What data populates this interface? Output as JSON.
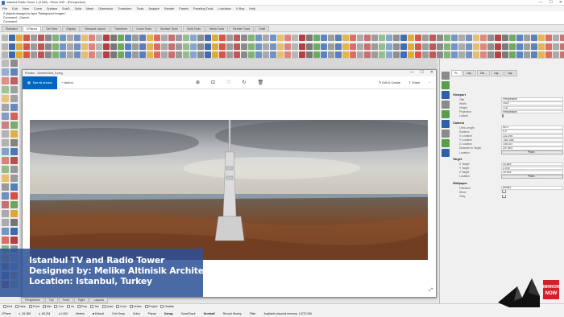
{
  "window": {
    "title": "Istanbul Radio Tower 1 (3 MB) - Rhino WIP - [Perspective]",
    "controls": [
      "—",
      "☐",
      "✕"
    ]
  },
  "menu": [
    "File",
    "Edit",
    "View",
    "Curve",
    "Surface",
    "SubD",
    "Solid",
    "Mesh",
    "Dimension",
    "Transform",
    "Tools",
    "Analyze",
    "Render",
    "Panels",
    "Paneling Tools",
    "Lunchbox",
    "V-Ray",
    "Help"
  ],
  "command_history": [
    "0 objects changed to layer \"Background Images\".",
    "Command: _Cancel",
    "Command:"
  ],
  "toolbar_tabs": [
    "Standard",
    "CPlanes",
    "Set View",
    "Display",
    "Viewport Layout",
    "Transform",
    "Curve Tools",
    "Surface Tools",
    "Solid Tools",
    "Mesh Tools",
    "Render Tools",
    "Draft"
  ],
  "active_toolbar_tab": "CPlanes",
  "colors": {
    "accent": "#0067c0",
    "overlay": "#2c5296",
    "red_icon": "#d33a2c",
    "blue_icon": "#3b6fb6",
    "gray_icon": "#8a8a8a"
  },
  "photos": {
    "title": "Photos - ScreenShot_5.png",
    "see_all": "See all photos",
    "add_to": "Add to",
    "edit_create": "Edit & Create",
    "share": "Share",
    "tool_icons": [
      "zoom-icon",
      "crop-icon",
      "heart-icon",
      "rotate-icon",
      "delete-icon"
    ]
  },
  "viewport_tabs": [
    "Perspective",
    "Top",
    "Front",
    "Right",
    "Layouts"
  ],
  "properties": {
    "tabs": [
      "Pr...",
      "Lay...",
      "Dis...",
      "Lay...",
      "Lay..."
    ],
    "viewport_section": "Viewport",
    "viewport_rows": [
      {
        "label": "Title",
        "value": "Perspective"
      },
      {
        "label": "Width",
        "value": "1423"
      },
      {
        "label": "Height",
        "value": "778"
      },
      {
        "label": "Projection",
        "value": "Perspective"
      },
      {
        "label": "Locked",
        "value": ""
      }
    ],
    "camera_section": "Camera",
    "camera_rows": [
      {
        "label": "Lens Length",
        "value": "50.0"
      },
      {
        "label": "Rotation",
        "value": "0.0"
      },
      {
        "label": "X Location",
        "value": "132.293"
      },
      {
        "label": "Y Location",
        "value": "-161.036"
      },
      {
        "label": "Z Location",
        "value": "105.037"
      },
      {
        "label": "Distance to Target",
        "value": "237.801"
      },
      {
        "label": "Location",
        "value": "Place..."
      }
    ],
    "target_section": "Target",
    "target_rows": [
      {
        "label": "X Target",
        "value": "22.629"
      },
      {
        "label": "Y Target",
        "value": "1.076"
      },
      {
        "label": "Z Target",
        "value": "10.915"
      },
      {
        "label": "Location",
        "value": "Place..."
      }
    ],
    "wallpaper_section": "Wallpaper",
    "wallpaper_rows": [
      {
        "label": "Filename",
        "value": "(none)"
      },
      {
        "label": "Show",
        "value": "✓"
      },
      {
        "label": "Gray",
        "value": "✓"
      }
    ]
  },
  "overlay": {
    "line1": "Istanbul TV and Radio Tower",
    "line2": "Designed by: Melike Altinisik Architects",
    "line3": "Location: Istanbul, Turkey"
  },
  "osnaps": [
    "End",
    "Near",
    "Point",
    "Mid",
    "Cen",
    "Int",
    "Perp",
    "Tan",
    "Quad",
    "Knot",
    "Vertex",
    "Project",
    "Disable"
  ],
  "status": {
    "cplane": "CPlane",
    "x": "x -26.285",
    "y": "y -65.261",
    "z": "z 0.000",
    "units": "Meters",
    "layer": "Default",
    "grid_snap": "Grid Snap",
    "ortho": "Ortho",
    "planar": "Planar",
    "osnap": "Osnap",
    "smarttrack": "SmartTrack",
    "gumball": "Gumball",
    "record_history": "Record History",
    "filter": "Filter",
    "memory": "Available physical memory: 14722 MB"
  },
  "logo_text": [
    "MIRROR",
    "NOW"
  ]
}
